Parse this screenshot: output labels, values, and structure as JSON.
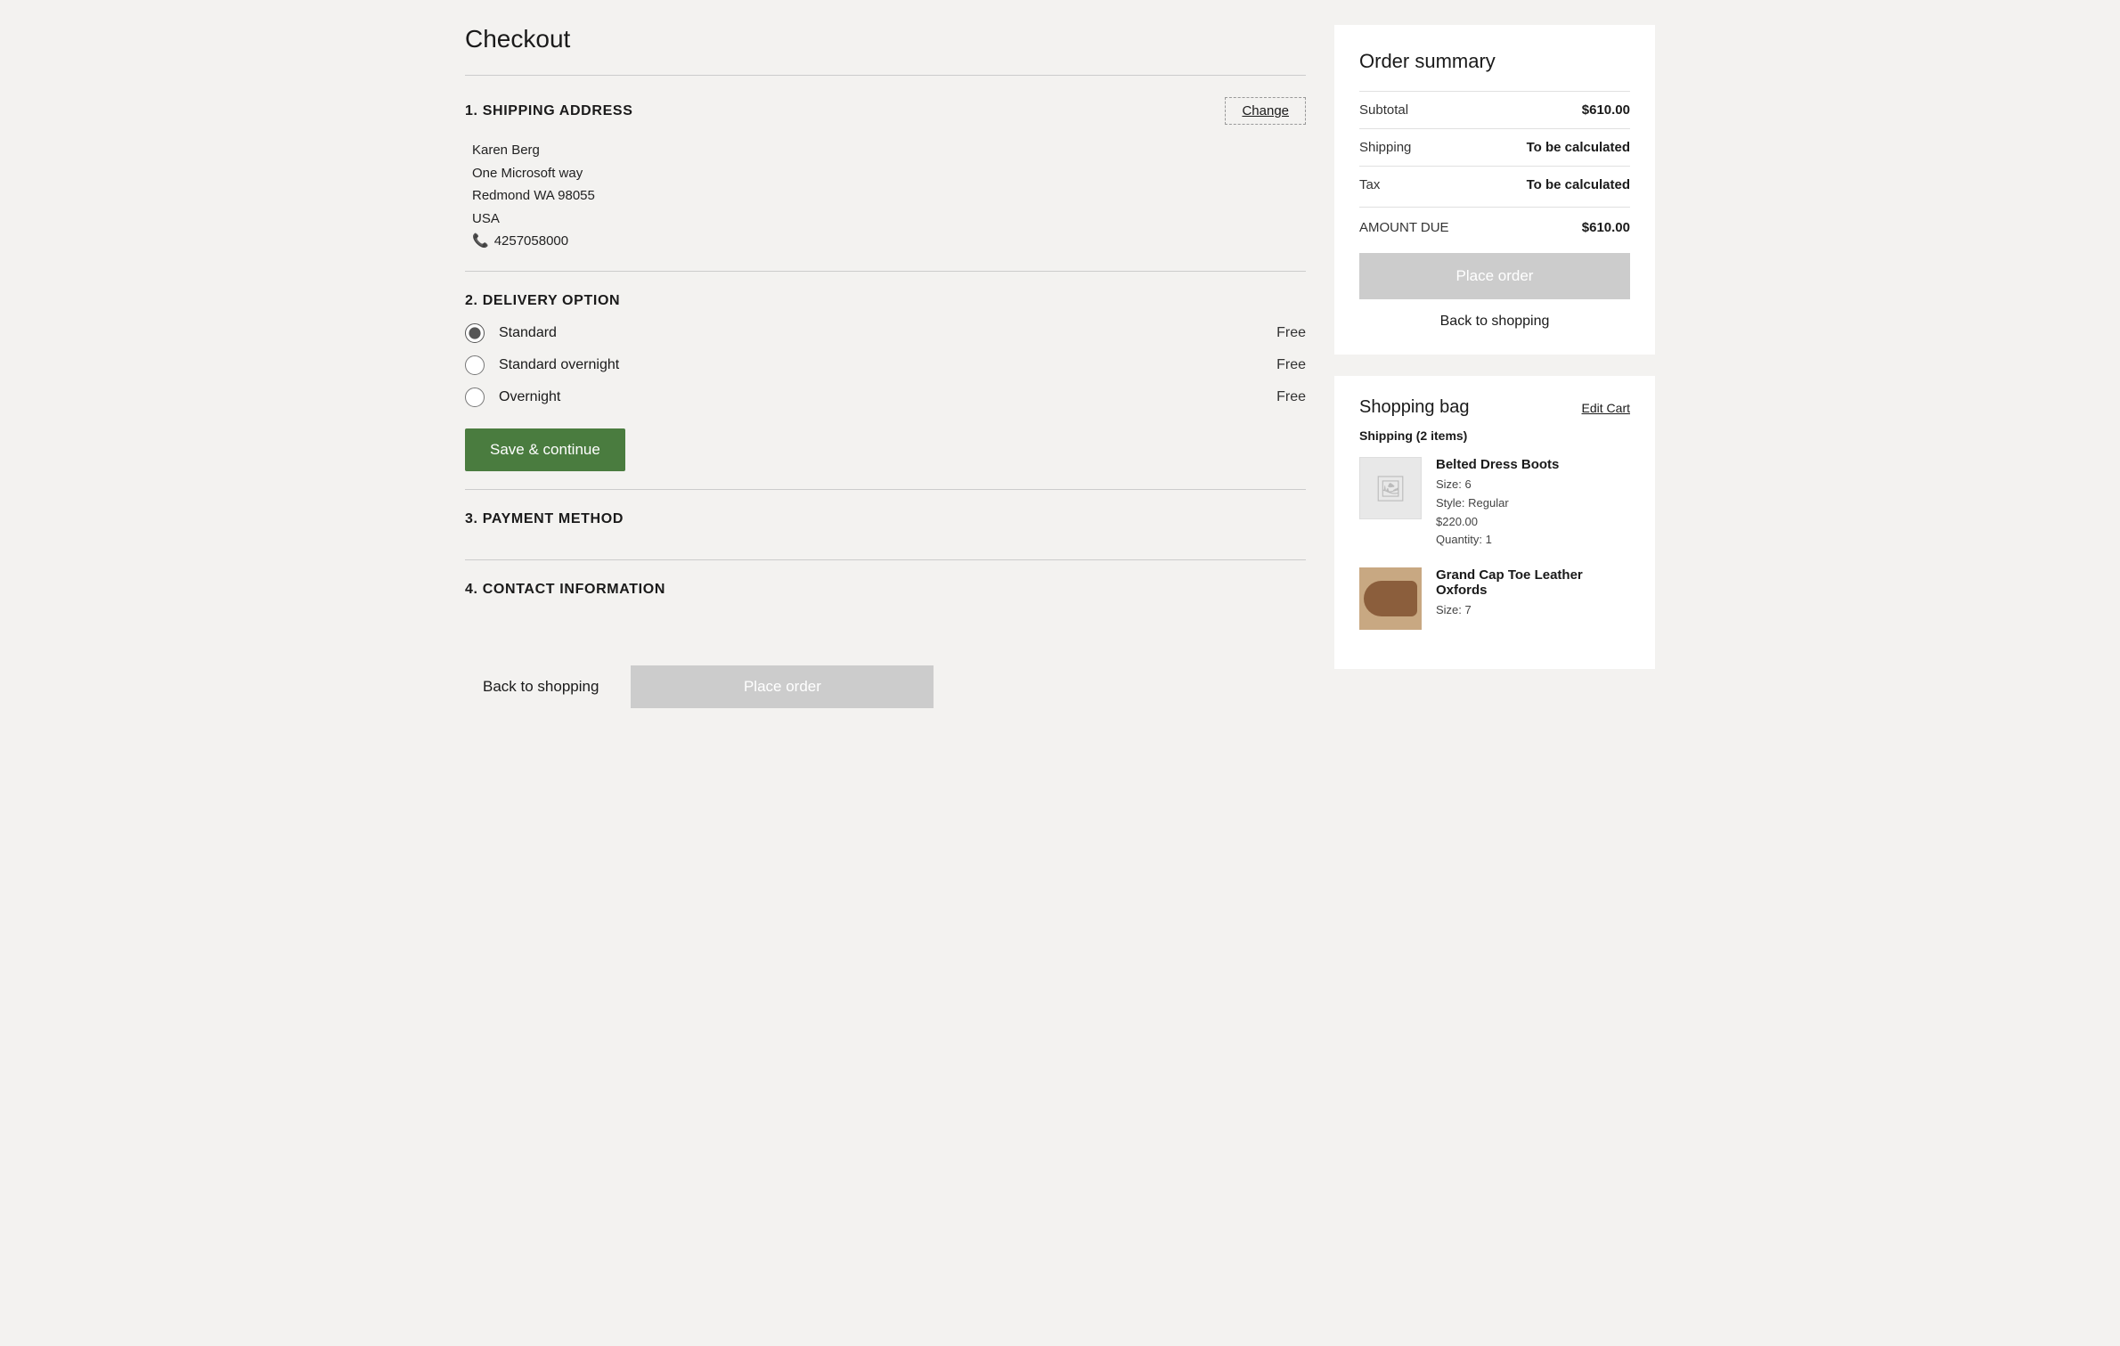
{
  "page": {
    "title": "Checkout"
  },
  "sections": {
    "shipping_address": {
      "number": "1.",
      "title": "SHIPPING ADDRESS",
      "change_label": "Change",
      "address": {
        "name": "Karen Berg",
        "street": "One Microsoft way",
        "city_state_zip": "Redmond WA  98055",
        "country": "USA",
        "phone": "4257058000"
      }
    },
    "delivery_option": {
      "number": "2.",
      "title": "DELIVERY OPTION",
      "options": [
        {
          "id": "standard",
          "label": "Standard",
          "price": "Free",
          "checked": true
        },
        {
          "id": "standard-overnight",
          "label": "Standard overnight",
          "price": "Free",
          "checked": false
        },
        {
          "id": "overnight",
          "label": "Overnight",
          "price": "Free",
          "checked": false
        }
      ],
      "save_label": "Save & continue"
    },
    "payment_method": {
      "number": "3.",
      "title": "PAYMENT METHOD"
    },
    "contact_information": {
      "number": "4.",
      "title": "CONTACT INFORMATION"
    }
  },
  "bottom_actions": {
    "back_label": "Back to shopping",
    "place_order_label": "Place order"
  },
  "order_summary": {
    "title": "Order summary",
    "rows": [
      {
        "label": "Subtotal",
        "value": "$610.00",
        "bold": true
      },
      {
        "label": "Shipping",
        "value": "To be calculated",
        "bold": true
      },
      {
        "label": "Tax",
        "value": "To be calculated",
        "bold": true
      }
    ],
    "amount_due_label": "AMOUNT DUE",
    "amount_due_value": "$610.00",
    "place_order_label": "Place order",
    "back_shopping_label": "Back to shopping"
  },
  "shopping_bag": {
    "title": "Shopping bag",
    "edit_cart_label": "Edit Cart",
    "shipping_label": "Shipping (2 items)",
    "items": [
      {
        "name": "Belted Dress Boots",
        "size": "Size: 6",
        "style": "Style: Regular",
        "price": "$220.00",
        "quantity": "Quantity: 1",
        "has_image": false
      },
      {
        "name": "Grand Cap Toe Leather Oxfords",
        "size": "Size: 7",
        "has_image": true
      }
    ]
  },
  "icons": {
    "phone": "📞",
    "image_placeholder": "🖼"
  }
}
